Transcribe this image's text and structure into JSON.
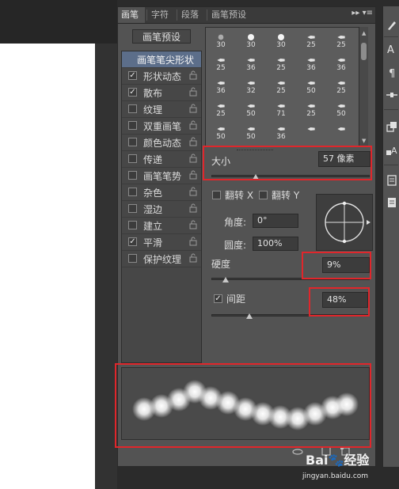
{
  "tabs": [
    {
      "label": "画笔",
      "active": true
    },
    {
      "label": "字符",
      "active": false
    },
    {
      "label": "段落",
      "active": false
    },
    {
      "label": "画笔预设",
      "active": false
    }
  ],
  "tab_menu": "▸▸ ▾≡",
  "brush_presets_button": "画笔预设",
  "option_list": [
    {
      "label": "画笔笔尖形状",
      "header": true
    },
    {
      "label": "形状动态",
      "checked": true
    },
    {
      "label": "散布",
      "checked": true
    },
    {
      "label": "纹理",
      "checked": false
    },
    {
      "label": "双重画笔",
      "checked": false
    },
    {
      "label": "颜色动态",
      "checked": false
    },
    {
      "label": "传递",
      "checked": false
    },
    {
      "label": "画笔笔势",
      "checked": false
    },
    {
      "label": "杂色",
      "checked": false
    },
    {
      "label": "湿边",
      "checked": false
    },
    {
      "label": "建立",
      "checked": false
    },
    {
      "label": "平滑",
      "checked": true
    },
    {
      "label": "保护纹理",
      "checked": false
    }
  ],
  "brush_grid": [
    [
      "30",
      "30",
      "30",
      "25",
      "25"
    ],
    [
      "25",
      "36",
      "25",
      "36",
      "36"
    ],
    [
      "36",
      "32",
      "25",
      "50",
      "25"
    ],
    [
      "25",
      "50",
      "71",
      "25",
      "50"
    ],
    [
      "50",
      "50",
      "36",
      "",
      ""
    ]
  ],
  "size": {
    "label": "大小",
    "value": "57 像素",
    "slider_fraction": 0.28
  },
  "flip_x": "翻转 X",
  "flip_y": "翻转 Y",
  "angle": {
    "label": "角度:",
    "value": "0°"
  },
  "roundness": {
    "label": "圆度:",
    "value": "100%"
  },
  "hardness": {
    "label": "硬度",
    "value": "9%",
    "slider_fraction": 0.09
  },
  "spacing": {
    "label": "间距",
    "value": "48%",
    "checked": true,
    "slider_fraction": 0.24
  },
  "check_mark": "✓",
  "watermark": {
    "text": "Bai🐾经验",
    "url": "jingyan.baidu.com"
  },
  "colors": {
    "accent_highlight": "#e0262b",
    "panel": "#535353",
    "header_selected": "#5c6e8a"
  }
}
